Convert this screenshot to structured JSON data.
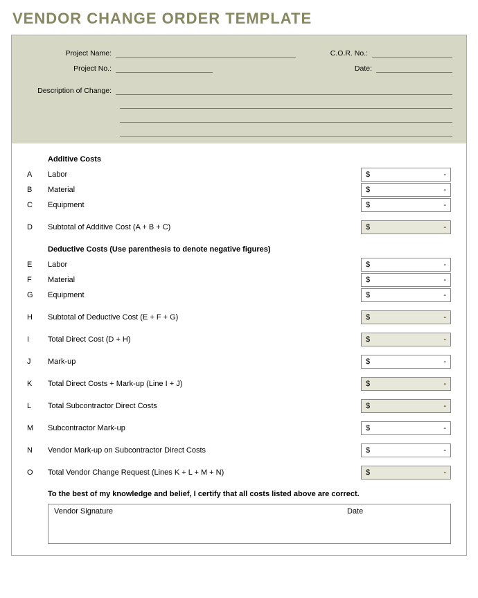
{
  "title": "VENDOR CHANGE ORDER TEMPLATE",
  "header": {
    "project_name_label": "Project Name:",
    "cor_no_label": "C.O.R. No.:",
    "project_no_label": "Project No.:",
    "date_label": "Date:",
    "description_label": "Description of Change:"
  },
  "sections": {
    "additive_heading": "Additive Costs",
    "deductive_heading": "Deductive Costs (Use parenthesis to denote negative figures)"
  },
  "rows": {
    "A": {
      "code": "A",
      "label": "Labor",
      "currency": "$",
      "value": "-"
    },
    "B": {
      "code": "B",
      "label": "Material",
      "currency": "$",
      "value": "-"
    },
    "C": {
      "code": "C",
      "label": "Equipment",
      "currency": "$",
      "value": "-"
    },
    "D": {
      "code": "D",
      "label": "Subtotal of Additive Cost (A + B + C)",
      "currency": "$",
      "value": "-"
    },
    "E": {
      "code": "E",
      "label": "Labor",
      "currency": "$",
      "value": "-"
    },
    "F": {
      "code": "F",
      "label": "Material",
      "currency": "$",
      "value": "-"
    },
    "G": {
      "code": "G",
      "label": "Equipment",
      "currency": "$",
      "value": "-"
    },
    "H": {
      "code": "H",
      "label": "Subtotal of Deductive Cost (E + F + G)",
      "currency": "$",
      "value": "-"
    },
    "I": {
      "code": "I",
      "label": "Total Direct Cost (D + H)",
      "currency": "$",
      "value": "-"
    },
    "J": {
      "code": "J",
      "label": "Mark-up",
      "currency": "$",
      "value": "-"
    },
    "K": {
      "code": "K",
      "label": "Total Direct Costs + Mark-up (Line I + J)",
      "currency": "$",
      "value": "-"
    },
    "L": {
      "code": "L",
      "label": "Total Subcontractor Direct Costs",
      "currency": "$",
      "value": "-"
    },
    "M": {
      "code": "M",
      "label": "Subcontractor Mark-up",
      "currency": "$",
      "value": "-"
    },
    "N": {
      "code": "N",
      "label": "Vendor Mark-up on Subcontractor Direct Costs",
      "currency": "$",
      "value": "-"
    },
    "O": {
      "code": "O",
      "label": "Total Vendor Change Request (Lines K + L + M + N)",
      "currency": "$",
      "value": "-"
    }
  },
  "certify": "To the best of my knowledge and belief, I certify that all costs listed above are correct.",
  "signature": {
    "vendor_label": "Vendor Signature",
    "date_label": "Date"
  }
}
